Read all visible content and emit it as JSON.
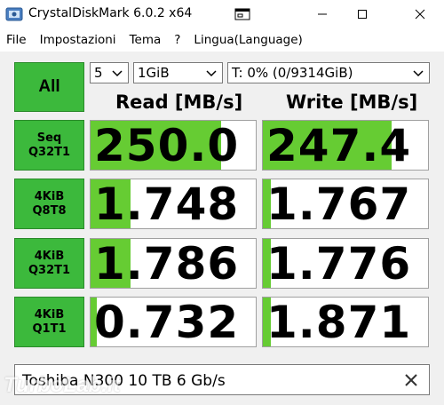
{
  "window": {
    "title": "CrystalDiskMark 6.0.2 x64"
  },
  "icons": {
    "app": "crystaldiskmark-icon",
    "screenshot": "screenshot-icon",
    "minimize": "minimize-icon",
    "maximize": "maximize-icon",
    "close": "close-icon",
    "dropdown": "chevron-down-icon",
    "clear": "clear-icon"
  },
  "menu": {
    "items": [
      "File",
      "Impostazioni",
      "Tema",
      "?",
      "Lingua(Language)"
    ]
  },
  "controls": {
    "all_label": "All",
    "count": "5",
    "size": "1GiB",
    "drive": "T: 0% (0/9314GiB)"
  },
  "headers": {
    "read": "Read [MB/s]",
    "write": "Write [MB/s]"
  },
  "tests": [
    {
      "line1": "Seq",
      "line2": "Q32T1",
      "read": "250.0",
      "write": "247.4",
      "read_fill": 0.79,
      "write_fill": 0.78
    },
    {
      "line1": "4KiB",
      "line2": "Q8T8",
      "read": "1.748",
      "write": "1.767",
      "read_fill": 0.24,
      "write_fill": 0.05
    },
    {
      "line1": "4KiB",
      "line2": "Q32T1",
      "read": "1.786",
      "write": "1.776",
      "read_fill": 0.24,
      "write_fill": 0.05
    },
    {
      "line1": "4KiB",
      "line2": "Q1T1",
      "read": "0.732",
      "write": "1.871",
      "read_fill": 0.04,
      "write_fill": 0.05
    }
  ],
  "comment": {
    "text": "Toshiba N300 10 TB 6 Gb/s"
  },
  "watermark": {
    "text": "TurboLab.it"
  },
  "colors": {
    "button_green": "#3cb93c",
    "bar_green": "#66cc33"
  }
}
